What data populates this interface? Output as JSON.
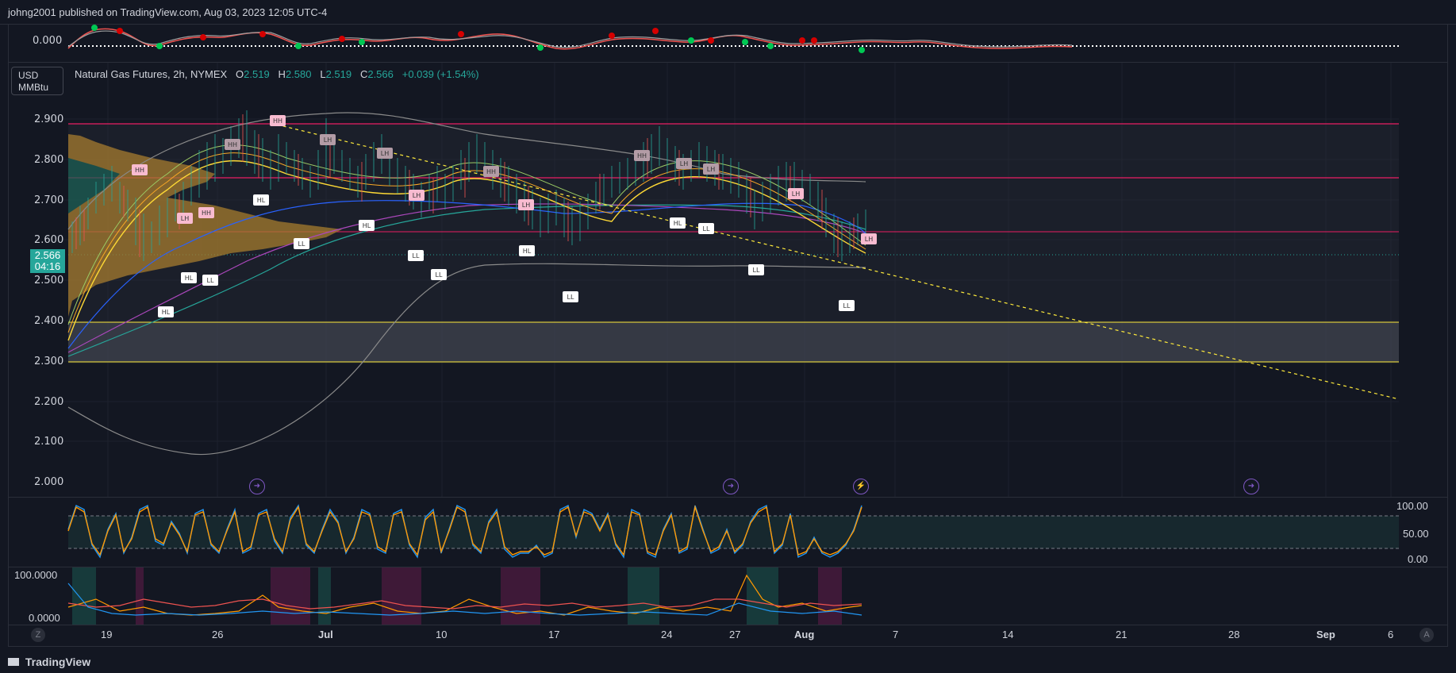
{
  "header": {
    "published": "johng2001 published on TradingView.com, Aug 03, 2023 12:05 UTC-4"
  },
  "unit": {
    "line1": "USD",
    "line2": "MMBtu"
  },
  "legend": {
    "title": "Natural Gas Futures, 2h, NYMEX",
    "open_label": "O",
    "open": "2.519",
    "high_label": "H",
    "high": "2.580",
    "low_label": "L",
    "low": "2.519",
    "close_label": "C",
    "close": "2.566",
    "change": "+0.039 (+1.54%)"
  },
  "price_tag": {
    "price": "2.566",
    "countdown": "04:16"
  },
  "osc_top": {
    "zero_label": "0.000"
  },
  "price_axis": [
    "2.900",
    "2.800",
    "2.700",
    "2.600",
    "2.500",
    "2.400",
    "2.300",
    "2.200",
    "2.100",
    "2.000"
  ],
  "stoch_axis": [
    "100.00",
    "50.00",
    "0.00"
  ],
  "ind2_axis": [
    "100.0000",
    "0.0000"
  ],
  "time_axis": [
    "19",
    "26",
    "Jul",
    "10",
    "17",
    "24",
    "27",
    "Aug",
    "7",
    "14",
    "21",
    "28",
    "Sep",
    "6"
  ],
  "pivot_labels": {
    "hh": "HH",
    "lh": "LH",
    "hl": "HL",
    "ll": "LL"
  },
  "footer": {
    "brand": "TradingView",
    "z_button": "Z",
    "a_button": "A"
  },
  "icons": {
    "event": "forward-arrow-icon",
    "flash": "lightning-icon"
  },
  "colors": {
    "background": "#131722",
    "up": "#26a69a",
    "down": "#ef5350",
    "resistance": "#e91e63",
    "support": "#ffeb3b",
    "trendline": "#ffeb3b"
  }
}
